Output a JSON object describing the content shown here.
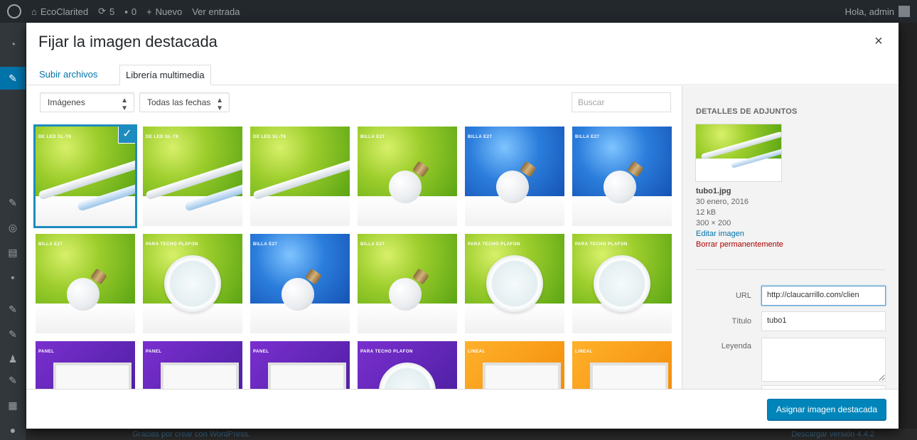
{
  "adminbar": {
    "site_name": "EcoClarited",
    "updates": "5",
    "comments": "0",
    "new_label": "Nuevo",
    "view_entry": "Ver entrada",
    "greeting": "Hola, admin"
  },
  "footer_bg": {
    "left_text": "Gracias por crear con WordPress.",
    "right_text": "Descargar versión 4.4.2"
  },
  "modal": {
    "title": "Fijar la imagen destacada",
    "close": "×",
    "tabs": [
      {
        "label": "Subir archivos"
      },
      {
        "label": "Librería multimedia"
      }
    ],
    "filters": {
      "type_value": "Imágenes",
      "date_value": "Todas las fechas",
      "search_placeholder": "Buscar"
    },
    "attachments": [
      {
        "label": "DE LED SL-T8",
        "bg": "green",
        "product": "tube"
      },
      {
        "label": "DE LED SL-T8",
        "bg": "green",
        "product": "tube"
      },
      {
        "label": "DE LED SL-T8",
        "bg": "green",
        "product": "tube"
      },
      {
        "label": "BILLA E27",
        "bg": "green",
        "product": "bulb"
      },
      {
        "label": "BILLA E27",
        "bg": "blue",
        "product": "bulb"
      },
      {
        "label": "BILLA E27",
        "bg": "blue",
        "product": "bulb"
      },
      {
        "label": "BILLA E27",
        "bg": "green",
        "product": "bulb"
      },
      {
        "label": "PARA TECHO PLAFON",
        "bg": "green",
        "product": "panel"
      },
      {
        "label": "BILLA E27",
        "bg": "blue",
        "product": "bulb"
      },
      {
        "label": "BILLA E27",
        "bg": "green",
        "product": "bulb"
      },
      {
        "label": "PARA TECHO PLAFON",
        "bg": "green",
        "product": "panel"
      },
      {
        "label": "PARA TECHO PLAFON",
        "bg": "green",
        "product": "panel"
      },
      {
        "label": "PANEL",
        "bg": "purple",
        "product": "flat"
      },
      {
        "label": "PANEL",
        "bg": "purple",
        "product": "flat"
      },
      {
        "label": "PANEL",
        "bg": "purple",
        "product": "flat"
      },
      {
        "label": "PARA TECHO PLAFON",
        "bg": "purple",
        "product": "panel"
      },
      {
        "label": "LINEAL",
        "bg": "orange",
        "product": "flat"
      },
      {
        "label": "LINEAL",
        "bg": "orange",
        "product": "flat"
      }
    ],
    "sidebar": {
      "heading": "Detalles de adjuntos",
      "filename": "tubo1.jpg",
      "date": "30 enero, 2016",
      "size": "12 kB",
      "dimensions": "300 × 200",
      "edit_link": "Editar imagen",
      "delete_link": "Borrar permanentemente",
      "url_label": "URL",
      "url_value": "http://claucarrillo.com/clien",
      "title_label": "Título",
      "title_value": "tubo1",
      "caption_label": "Leyenda"
    },
    "primary_button": "Asignar imagen destacada"
  },
  "colors": {
    "accent": "#0073aa",
    "selection": "#1e8cbe",
    "danger": "#a00"
  }
}
